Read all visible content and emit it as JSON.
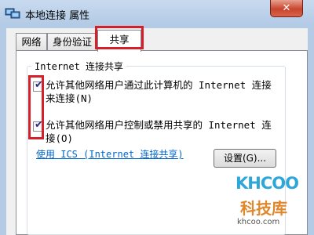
{
  "window": {
    "title": "本地连接 属性",
    "close_label": "✕"
  },
  "tabs": [
    {
      "label": "网络",
      "active": false
    },
    {
      "label": "身份验证",
      "active": false
    },
    {
      "label": "共享",
      "active": true
    }
  ],
  "group": {
    "legend": "Internet 连接共享"
  },
  "options": [
    {
      "line1": "允许其他网络用户通过此计算机的 Internet 连接",
      "line2": "来连接(N)",
      "checked": true
    },
    {
      "line1": "允许其他网络用户控制或禁用共享的 Internet 连",
      "line2": "接(O)",
      "checked": true
    }
  ],
  "link": {
    "text": "使用 ICS (Internet 连接共享)"
  },
  "settings_button": {
    "label": "设置(G)..."
  },
  "watermark": {
    "logo": "KHCOO",
    "name": "科技库",
    "url": "khcoo.com"
  },
  "colors": {
    "highlight": "#d3202b",
    "link": "#0066cc",
    "titlebar": "#b4cbe6"
  }
}
